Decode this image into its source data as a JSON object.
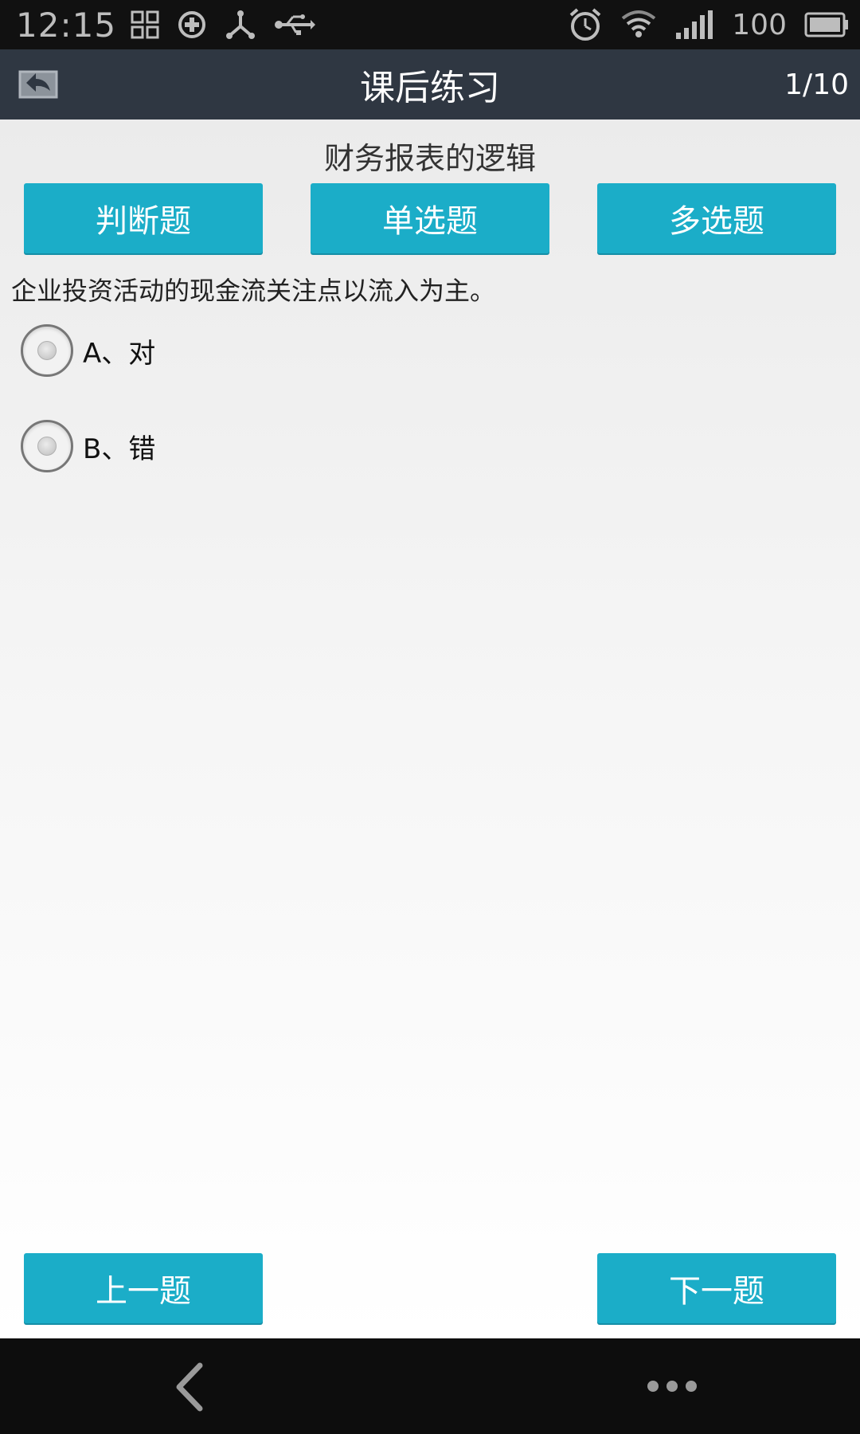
{
  "status_bar": {
    "time": "12:15",
    "battery_percent": "100",
    "icons_left": [
      "grid-icon",
      "sync-icon",
      "share-icon",
      "usb-icon"
    ],
    "icons_right": [
      "alarm-icon",
      "wifi-icon",
      "signal-icon",
      "battery-icon"
    ]
  },
  "header": {
    "title": "课后练习",
    "progress": "1/10",
    "back_icon": "back-icon"
  },
  "subject": {
    "title": "财务报表的逻辑"
  },
  "tabs": [
    {
      "label": "判断题"
    },
    {
      "label": "单选题"
    },
    {
      "label": "多选题"
    }
  ],
  "question": {
    "text": "企业投资活动的现金流关注点以流入为主。",
    "options": [
      {
        "label": "A、对",
        "selected": false
      },
      {
        "label": "B、错",
        "selected": false
      }
    ]
  },
  "navigation": {
    "prev_label": "上一题",
    "next_label": "下一题"
  },
  "colors": {
    "accent": "#1badc8",
    "title_bar": "#2f3742",
    "status_bar": "#111111"
  }
}
